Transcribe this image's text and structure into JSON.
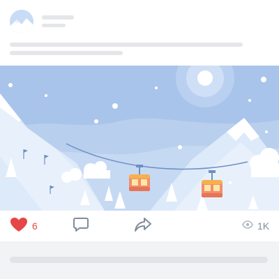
{
  "post": {
    "actions": {
      "like": {
        "count": "6",
        "icon": "heart-icon",
        "color": "#e64646"
      },
      "comment": {
        "icon": "comment-icon"
      },
      "share": {
        "icon": "share-icon"
      },
      "views": {
        "count": "1K",
        "icon": "eye-icon"
      }
    }
  },
  "colors": {
    "sky": "#a9c4ea",
    "accent_red": "#e64646",
    "muted": "#818c99",
    "placeholder": "#e4e6ea"
  }
}
